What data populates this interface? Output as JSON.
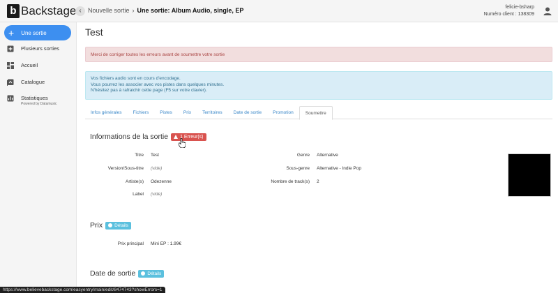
{
  "brand": {
    "logo_letter": "b",
    "logo_name": "Backstage"
  },
  "header": {
    "back_symbol": "‹",
    "breadcrumb_1": "Nouvelle sortie",
    "breadcrumb_sep": "›",
    "breadcrumb_2": "Une sortie: Album Audio, single, EP",
    "user_name": "felicie-bsharp",
    "client_number": "Numéro client : 138309"
  },
  "sidebar": {
    "new_button": "Une sortie",
    "items": [
      {
        "label": "Plusieurs sorties",
        "icon": "plus-square-icon"
      },
      {
        "label": "Accueil",
        "icon": "dashboard-icon"
      },
      {
        "label": "Catalogue",
        "icon": "catalog-icon"
      },
      {
        "label": "Statistiques",
        "sub": "Powered by Datamusic",
        "icon": "chart-icon"
      }
    ]
  },
  "page": {
    "title": "Test",
    "alert_error": "Merci de corriger toutes les erreurs avant de soumettre votre sortie",
    "alert_info_lines": [
      "Vos fichiers audio sont en cours d'encodage.",
      "Vous pourrez les associer avec vos pistes dans quelques minutes.",
      "N'hésitez pas à rafraichir cette page (F5 sur votre clavier)."
    ]
  },
  "tabs": [
    "Infos générales",
    "Fichiers",
    "Pistes",
    "Prix",
    "Territoires",
    "Date de sortie",
    "Promotion",
    "Soumettre"
  ],
  "active_tab": "Soumettre",
  "release_info": {
    "heading": "Informations de la sortie",
    "error_badge": "1 Erreur(s)",
    "left": {
      "titre_label": "Titre",
      "titre_value": "Test",
      "version_label": "Version/Sous-titre",
      "version_value": "(vide)",
      "artiste_label": "Artiste(s)",
      "artiste_value": "Odezenne",
      "label_label": "Label",
      "label_value": "(vide)"
    },
    "right": {
      "genre_label": "Genre",
      "genre_value": "Alternative",
      "sousgenre_label": "Sous-genre",
      "sousgenre_value": "Alternative - Indie Pop",
      "tracks_label": "Nombre de track(s)",
      "tracks_value": "2"
    }
  },
  "price": {
    "heading": "Prix",
    "details_badge": "Détails",
    "principal_label": "Prix principal",
    "principal_value": "Mini EP : 1.99€"
  },
  "release_date": {
    "heading": "Date de sortie",
    "details_badge": "Détails"
  },
  "status_url": "https://www.believebackstage.com/easyentry/main/edit/8474743?showErrors=1",
  "colors": {
    "accent": "#3d8ff0",
    "error": "#d9534f",
    "info": "#5bc0de",
    "alert_danger_bg": "#f2dede",
    "alert_info_bg": "#d9edf7"
  }
}
